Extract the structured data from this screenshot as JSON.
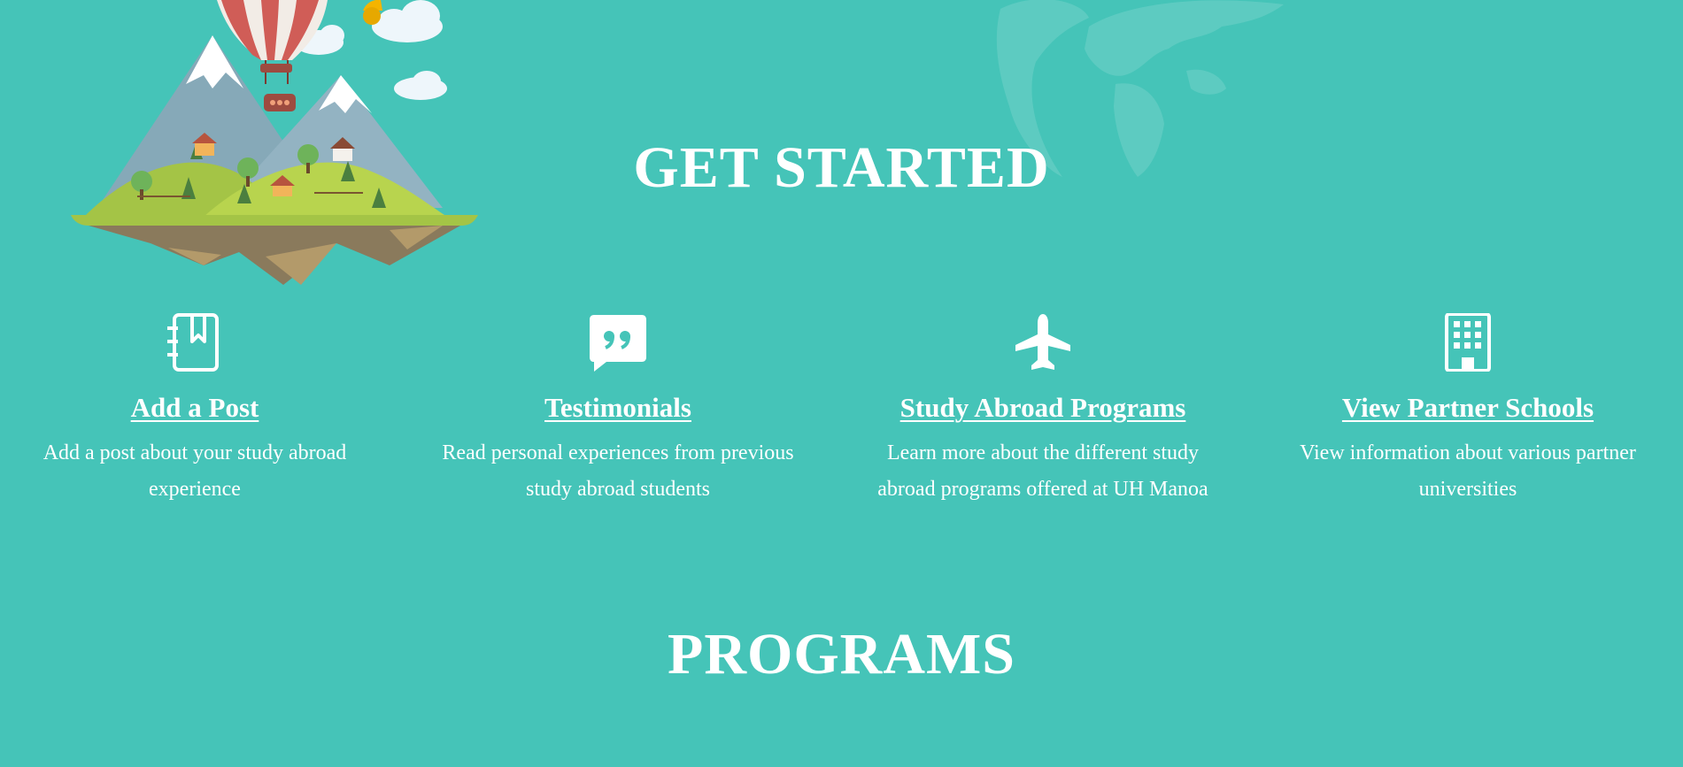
{
  "page": {
    "get_started_heading": "GET STARTED",
    "programs_heading": "PROGRAMS"
  },
  "colors": {
    "background": "#45c4b8",
    "text": "#ffffff"
  },
  "features": [
    {
      "icon": "address-book-icon",
      "title": "Add a Post",
      "description": "Add a post about your study abroad experience"
    },
    {
      "icon": "quote-speech-bubble-icon",
      "title": "Testimonials",
      "description": "Read personal experiences from previous study abroad students"
    },
    {
      "icon": "airplane-icon",
      "title": "Study Abroad Programs",
      "description": "Learn more about the different study abroad programs offered at UH Manoa"
    },
    {
      "icon": "building-icon",
      "title": "View Partner Schools",
      "description": "View information about various partner universities"
    }
  ]
}
